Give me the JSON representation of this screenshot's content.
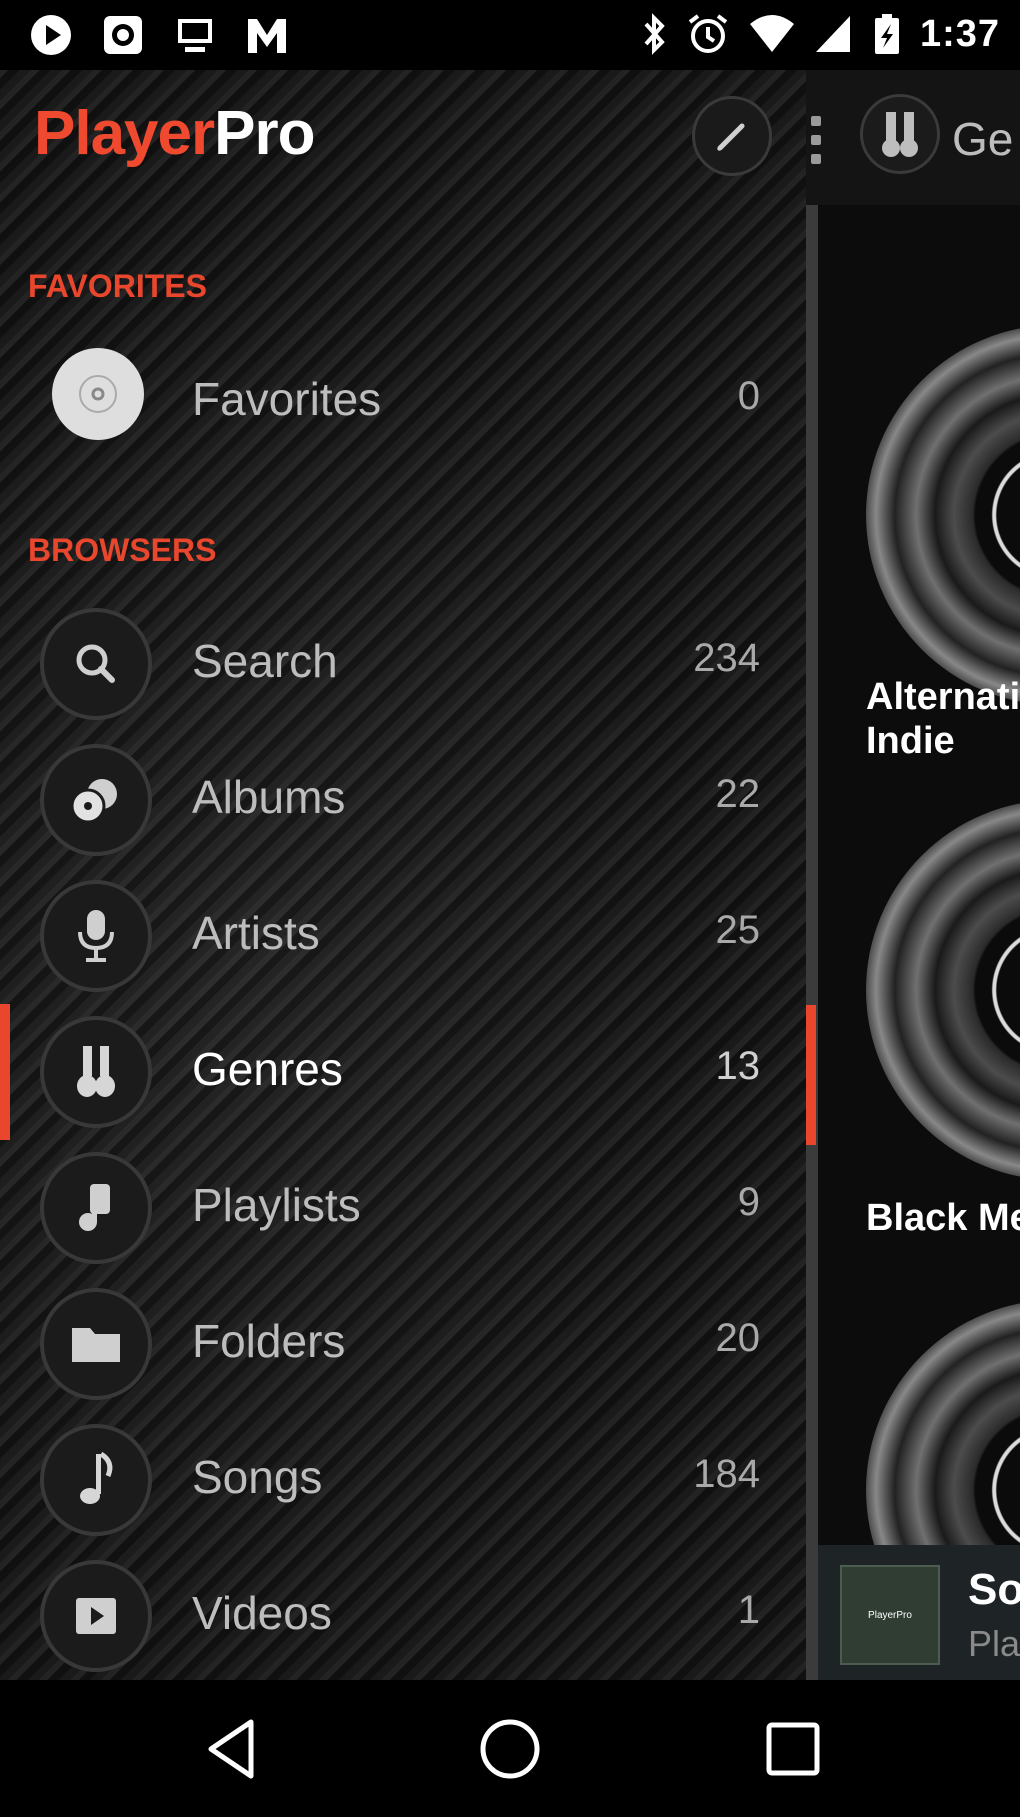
{
  "status_bar": {
    "time": "1:37",
    "left_icons": [
      "play-icon",
      "record-icon",
      "cast-icon",
      "gmail-icon"
    ],
    "right_icons": [
      "bluetooth-icon",
      "alarm-icon",
      "wifi-icon",
      "signal-icon",
      "battery-icon"
    ]
  },
  "app": {
    "logo_part1": "Player",
    "logo_part2": "Pro",
    "accent_color": "#e8472e"
  },
  "header": {
    "current_browser_label": "Ge"
  },
  "drawer": {
    "sections": [
      {
        "title": "FAVORITES"
      },
      {
        "title": "BROWSERS"
      }
    ],
    "favorites": [
      {
        "label": "Favorites",
        "count": "0",
        "icon": "disc-icon"
      }
    ],
    "browsers": [
      {
        "label": "Search",
        "count": "234",
        "icon": "search-icon"
      },
      {
        "label": "Albums",
        "count": "22",
        "icon": "albums-icon"
      },
      {
        "label": "Artists",
        "count": "25",
        "icon": "microphone-icon"
      },
      {
        "label": "Genres",
        "count": "13",
        "icon": "guitar-icon",
        "active": true
      },
      {
        "label": "Playlists",
        "count": "9",
        "icon": "playlist-icon"
      },
      {
        "label": "Folders",
        "count": "20",
        "icon": "folder-icon"
      },
      {
        "label": "Songs",
        "count": "184",
        "icon": "music-note-icon"
      },
      {
        "label": "Videos",
        "count": "1",
        "icon": "video-icon"
      }
    ]
  },
  "content": {
    "cards": [
      {
        "title_line1": "Alternati",
        "title_line2": "Indie"
      },
      {
        "title_line1": "Black Me",
        "title_line2": ""
      },
      {
        "title_line1": "",
        "title_line2": ""
      }
    ]
  },
  "mini_player": {
    "title": "So",
    "subtitle": "Pla",
    "art_label": "PlayerPro"
  },
  "nav_bar": {
    "buttons": [
      "back-icon",
      "home-icon",
      "recents-icon"
    ]
  }
}
